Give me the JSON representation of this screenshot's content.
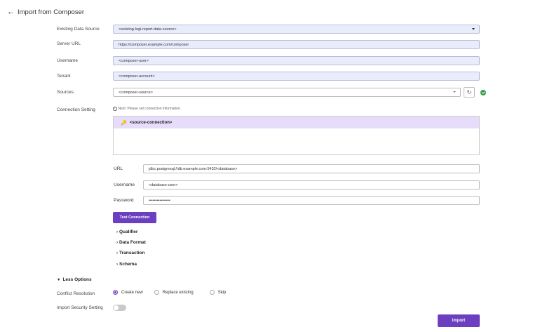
{
  "header": {
    "back_icon": "←",
    "title": "Import from Composer"
  },
  "form": {
    "existing_data_source": {
      "label": "Existing Data Source",
      "value": "<existing-logi-report-data-source>"
    },
    "server_url": {
      "label": "Server URL",
      "value": "https://composer.example.com/composer"
    },
    "username": {
      "label": "Username",
      "value": "<composer-user>"
    },
    "tenant": {
      "label": "Tenant",
      "value": "<composer-account>"
    },
    "sources": {
      "label": "Sources",
      "value": "<composer-source>",
      "refresh_icon": "↻"
    },
    "connection_setting": {
      "label": "Connection Setting",
      "hint_icon": "i",
      "hint": "Next: Please set connection information.",
      "items": [
        {
          "icon": "🔑",
          "label": "<source-connection>"
        }
      ]
    },
    "url": {
      "label": "URL",
      "value": "jdbc:postgresql://db.example.com:5432/<database>"
    },
    "db_username": {
      "label": "Username",
      "value": "<database-user>"
    },
    "db_password": {
      "label": "Password",
      "value": "••••••••••••••••"
    },
    "test_connection_button": "Test Connection",
    "sections": [
      {
        "chevron": "›",
        "label": "Qualifier"
      },
      {
        "chevron": "›",
        "label": "Data Format"
      },
      {
        "chevron": "›",
        "label": "Transaction"
      },
      {
        "chevron": "›",
        "label": "Schema"
      }
    ]
  },
  "options": {
    "toggle_icon": "▼",
    "title": "Less Options",
    "conflict_resolution": {
      "label": "Conflict Resolution",
      "choices": [
        "Create new",
        "Replace existing",
        "Skip"
      ],
      "selected": "Create new"
    },
    "import_security_setting": {
      "label": "Import Security Setting",
      "enabled": false
    }
  },
  "import_button": "Import",
  "colors": {
    "accent": "#6b3fbf",
    "field_bg": "#e9edfb",
    "success": "#2e9e48"
  }
}
